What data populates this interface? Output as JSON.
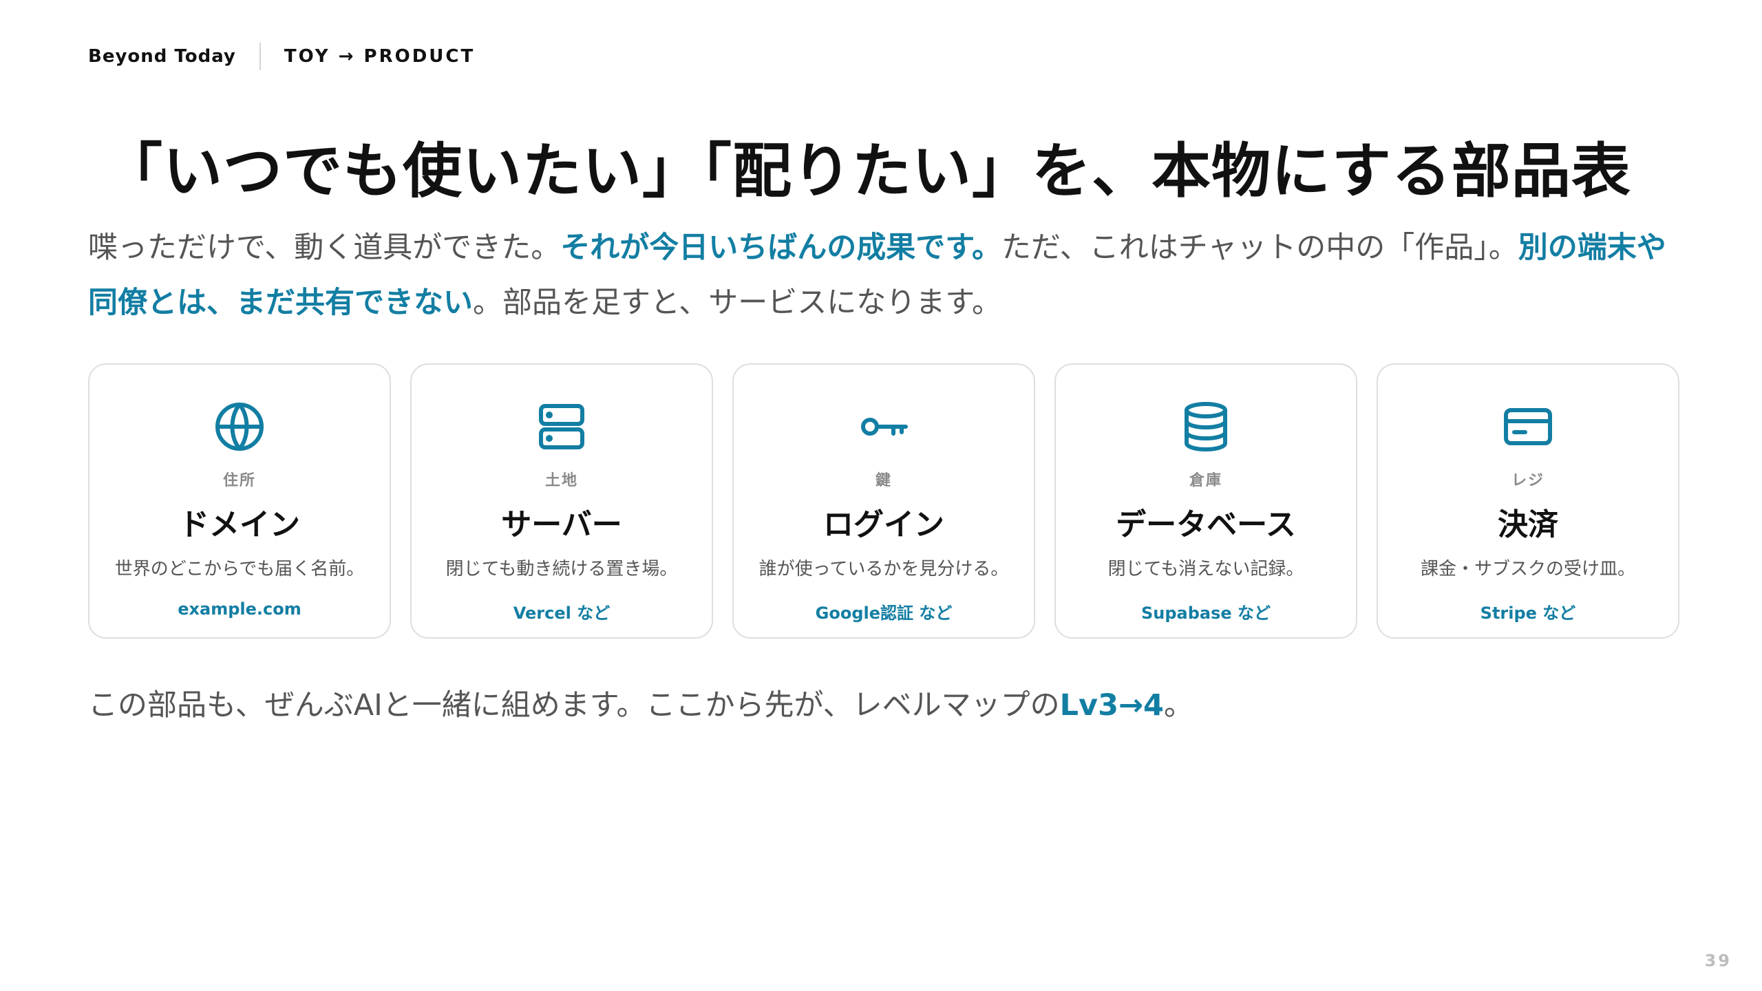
{
  "header": {
    "brand": "Beyond Today",
    "section": "TOY → PRODUCT"
  },
  "title": "「いつでも使いたい」「配りたい」を、本物にする部品表",
  "lead": {
    "part1": "喋っただけで、動く道具ができた。",
    "highlight1": "それが今日いちばんの成果です。",
    "part2": "ただ、これはチャットの中の「作品」。",
    "highlight2": "別の端末や同僚とは、まだ共有できない",
    "part3": "。部品を足すと、サービスになります。"
  },
  "cards": [
    {
      "icon": "globe-icon",
      "tag": "住所",
      "name": "ドメイン",
      "desc": "世界のどこからでも届く名前。",
      "example": "example.com"
    },
    {
      "icon": "server-icon",
      "tag": "土地",
      "name": "サーバー",
      "desc": "閉じても動き続ける置き場。",
      "example": "Vercel など"
    },
    {
      "icon": "key-icon",
      "tag": "鍵",
      "name": "ログイン",
      "desc": "誰が使っているかを見分ける。",
      "example": "Google認証 など"
    },
    {
      "icon": "database-icon",
      "tag": "倉庫",
      "name": "データベース",
      "desc": "閉じても消えない記録。",
      "example": "Supabase など"
    },
    {
      "icon": "credit-card-icon",
      "tag": "レジ",
      "name": "決済",
      "desc": "課金・サブスクの受け皿。",
      "example": "Stripe など"
    }
  ],
  "footer": {
    "text": "この部品も、ぜんぶAIと一緒に組めます。ここから先が、レベルマップの",
    "highlight": "Lv3→4",
    "end": "。"
  },
  "page_number": "39",
  "colors": {
    "accent": "#137ea3",
    "text": "#111111",
    "muted": "#555555",
    "border": "#dedede"
  }
}
